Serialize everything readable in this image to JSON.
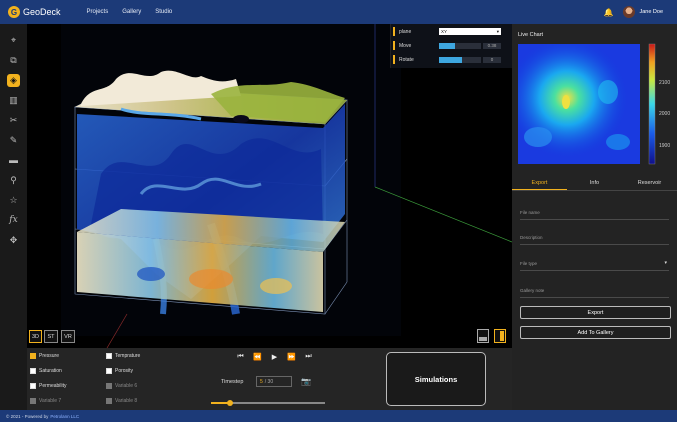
{
  "app": {
    "name": "GeoDeck",
    "logo_letter": "G",
    "nav": [
      "Projects",
      "Gallery",
      "Studio"
    ],
    "user": "Jane Doe"
  },
  "tools": [
    "crosshair-icon",
    "crop-icon",
    "layers-icon",
    "building-icon",
    "scissors-icon",
    "pen-icon",
    "paint-roller-icon",
    "pipette-icon",
    "star-icon",
    "function-icon",
    "move-icon"
  ],
  "tools_active_index": 2,
  "viewport_controls": {
    "plane_label": "plane",
    "plane_value": "XY",
    "move_label": "Move",
    "move_value": "0.38",
    "move_fraction": 0.38,
    "rotate_label": "Rotate",
    "rotate_value": "0",
    "rotate_fraction": 0.55
  },
  "view_modes": [
    "3D",
    "ST",
    "VR"
  ],
  "view_mode_active": "3D",
  "properties": {
    "left": [
      {
        "label": "Pressure",
        "state": "on"
      },
      {
        "label": "Saturation",
        "state": "off"
      },
      {
        "label": "Permeability",
        "state": "off"
      },
      {
        "label": "Variable 7",
        "state": "dim"
      }
    ],
    "right": [
      {
        "label": "Temprature",
        "state": "off"
      },
      {
        "label": "Porosity",
        "state": "off"
      },
      {
        "label": "Variable 6",
        "state": "dim"
      },
      {
        "label": "Variable 8",
        "state": "dim"
      }
    ]
  },
  "playback": {
    "timestep_label": "Timestep",
    "timestep_current": "5",
    "timestep_total": "/ 30",
    "progress": 0.17
  },
  "simulations_label": "Simulations",
  "right_panel": {
    "chart_title": "Live Chart",
    "colorbar_ticks": [
      "2100",
      "2000",
      "1900"
    ],
    "tabs": [
      "Export",
      "Info",
      "Reservoir"
    ],
    "active_tab": "Export",
    "fields": [
      "File name",
      "Description",
      "File type",
      "Gallery note"
    ],
    "export_button": "Export",
    "gallery_button": "Add To Gallery"
  },
  "footer": {
    "text": "© 2021 - Powered by",
    "link": "Petrolann LLC"
  },
  "colors": {
    "brand": "#1c3a78",
    "accent": "#f2b21e"
  }
}
